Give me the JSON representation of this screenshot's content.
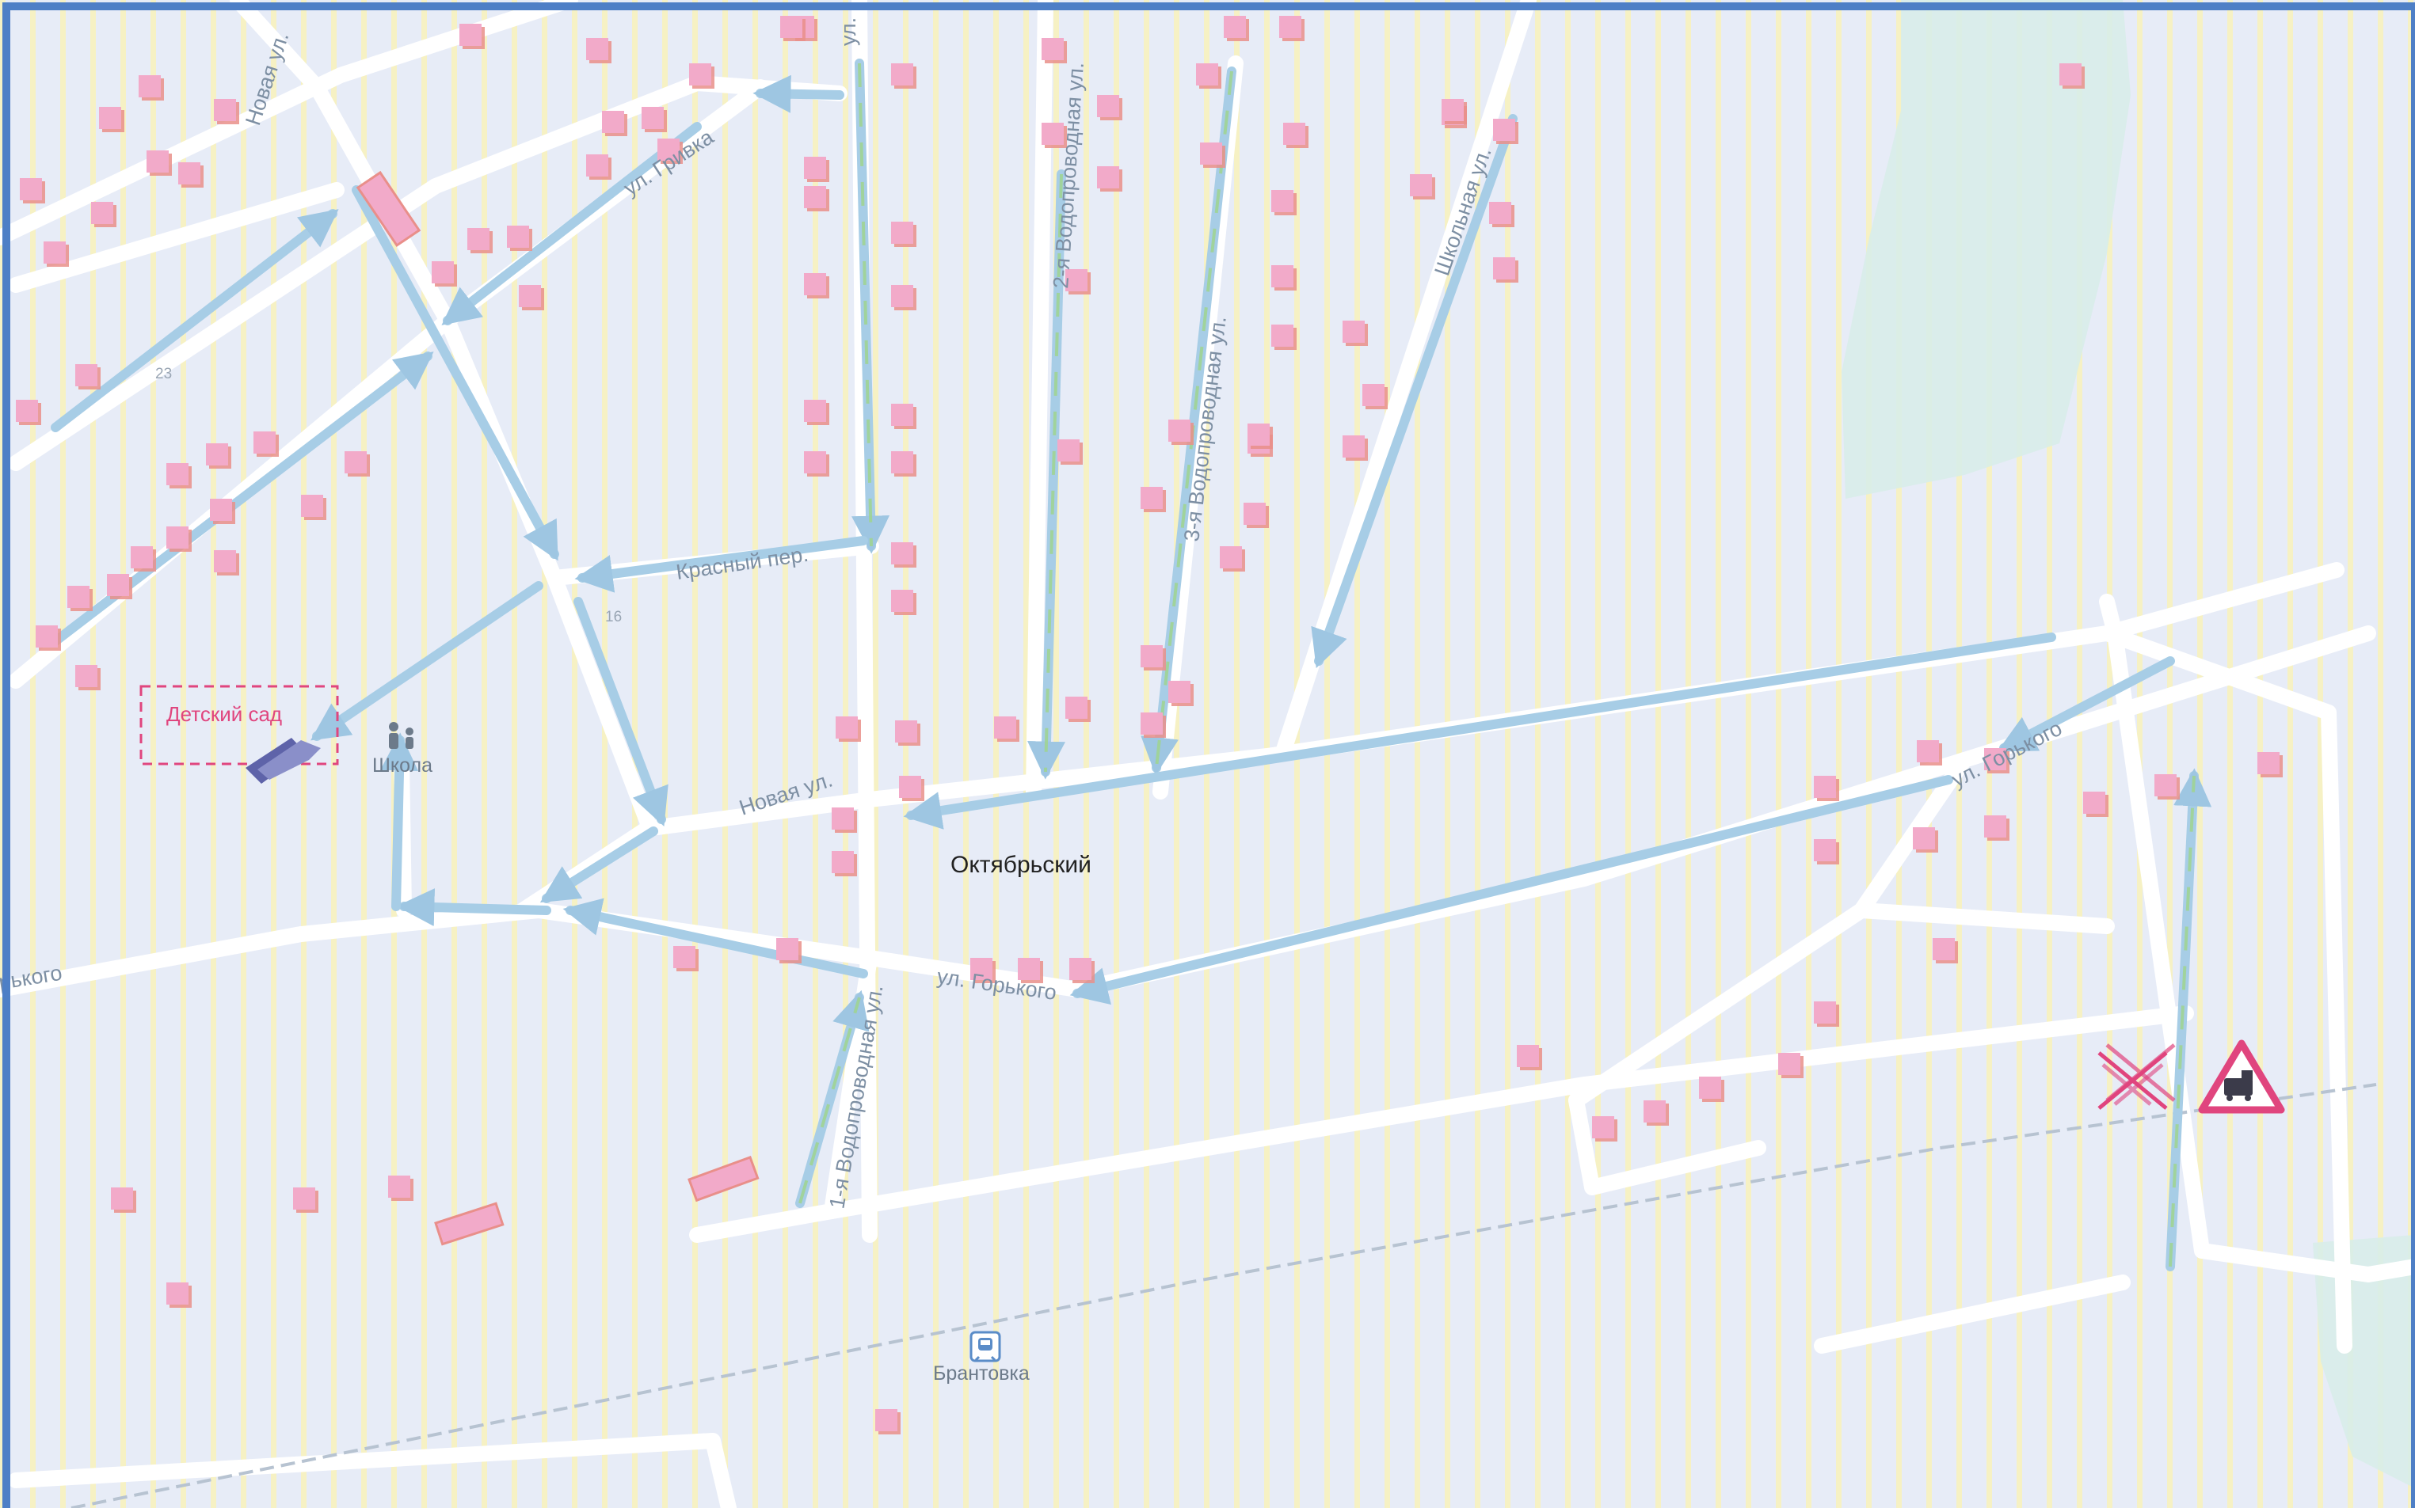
{
  "map": {
    "settlement": "Октябрьский",
    "colors": {
      "ground": "#edeef3",
      "stripe_a": "#f6f1c4",
      "stripe_b": "#e7ecf7",
      "water": "#d8ede9",
      "road": "#ffffff",
      "border": "#4e7fc6",
      "house": "#f2aac9",
      "house_side": "#e98f8a",
      "route_arrow": "#a7cde6",
      "route_green": "#9fd48a",
      "kinder": "#e0457e",
      "school_building": "#5e63a9",
      "rail": "#b7c3d1"
    },
    "streets": [
      {
        "id": "novaya-top",
        "label": "Новая ул."
      },
      {
        "id": "grivka",
        "label": "ул. Гривка"
      },
      {
        "id": "vodoprovodnaya-2",
        "label": "2-я Водопроводная ул."
      },
      {
        "id": "vodoprovodnaya-3",
        "label": "3-я Водопроводная ул."
      },
      {
        "id": "shkolnaya",
        "label": "Школьная ул."
      },
      {
        "id": "krasny",
        "label": "Красный пер."
      },
      {
        "id": "novaya-mid",
        "label": "Новая ул."
      },
      {
        "id": "gorkogo-mid",
        "label": "ул. Горького"
      },
      {
        "id": "gorkogo-east",
        "label": "ул. Горького"
      },
      {
        "id": "gorkogo-west",
        "label": "рького"
      },
      {
        "id": "vodoprovodnaya-1",
        "label": "1-я Водопроводная ул."
      },
      {
        "id": "ul-top",
        "label": "ул."
      }
    ],
    "house_numbers": [
      "23",
      "16"
    ],
    "pois": {
      "kindergarten": "Детский сад",
      "school": "Школа",
      "station": "Брантовка"
    },
    "icons": {
      "school": "children-icon",
      "station": "train-station-icon",
      "crossing": "railway-crossing-icon",
      "warning": "train-warning-sign-icon"
    }
  }
}
